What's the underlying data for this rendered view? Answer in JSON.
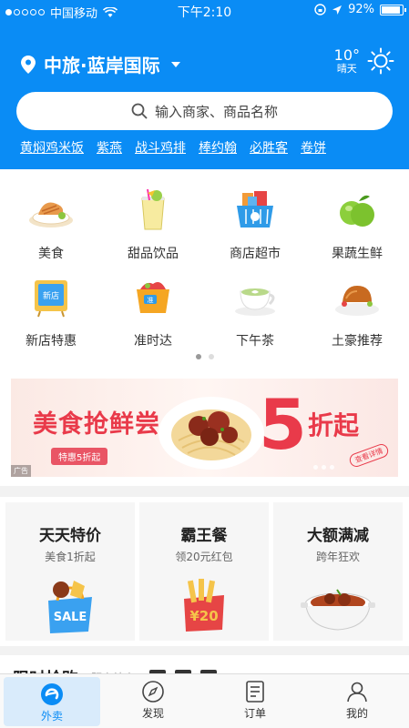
{
  "status": {
    "carrier": "中国移动",
    "time": "下午2:10",
    "battery": "92%",
    "battery_level": 0.92
  },
  "header": {
    "location": "中旅·蓝岸国际",
    "weather_temp": "10°",
    "weather_desc": "晴天"
  },
  "search": {
    "placeholder": "输入商家、商品名称"
  },
  "hot_words": [
    "黄焖鸡米饭",
    "紫燕",
    "战斗鸡排",
    "棒约翰",
    "必胜客",
    "卷饼"
  ],
  "categories": [
    {
      "label": "美食",
      "icon": "food-icon"
    },
    {
      "label": "甜品饮品",
      "icon": "drink-icon"
    },
    {
      "label": "商店超市",
      "icon": "supermarket-icon"
    },
    {
      "label": "果蔬生鲜",
      "icon": "fruit-icon"
    },
    {
      "label": "新店特惠",
      "icon": "new-store-icon"
    },
    {
      "label": "准时达",
      "icon": "on-time-icon"
    },
    {
      "label": "下午茶",
      "icon": "afternoon-tea-icon"
    },
    {
      "label": "土豪推荐",
      "icon": "premium-icon"
    }
  ],
  "banner": {
    "title": "美食抢鲜尝",
    "subtitle": "特惠5折起",
    "big_number": "5",
    "suffix": "折起",
    "ad_label": "广告",
    "detail_label": "查看详情"
  },
  "promos": [
    {
      "title": "天天特价",
      "subtitle": "美食1折起",
      "icon": "sale-bag-icon",
      "badge": "SALE"
    },
    {
      "title": "霸王餐",
      "subtitle": "领20元红包",
      "icon": "red-packet-icon",
      "badge": "¥20"
    },
    {
      "title": "大额满减",
      "subtitle": "跨年狂欢",
      "icon": "hotpot-icon"
    }
  ],
  "limited": {
    "title": "限时抢购",
    "subtitle": "距离结束"
  },
  "tabs": [
    {
      "label": "外卖",
      "icon": "takeout-icon"
    },
    {
      "label": "发现",
      "icon": "compass-icon"
    },
    {
      "label": "订单",
      "icon": "order-icon"
    },
    {
      "label": "我的",
      "icon": "profile-icon"
    }
  ],
  "colors": {
    "brand_blue": "#0a8cf5",
    "banner_red": "#e93a4a"
  }
}
